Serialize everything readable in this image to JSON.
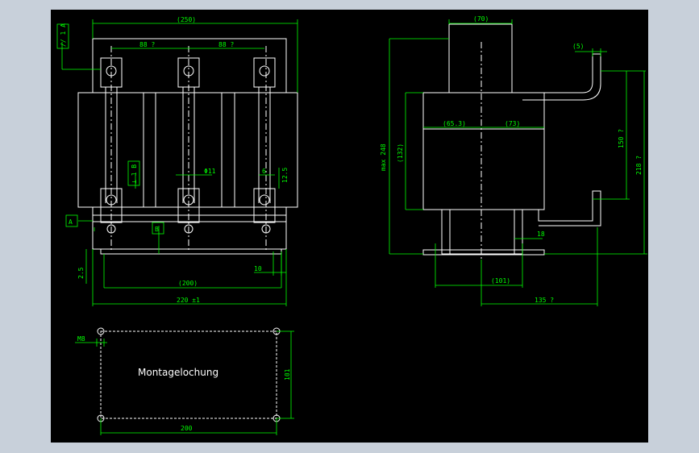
{
  "colors": {
    "outer_bg": "#c8d0da",
    "canvas_bg": "#000000",
    "drawing": "#ffffff",
    "dimension": "#00ff00"
  },
  "front_view": {
    "dim_top": "(250)",
    "dim_pitch_left": "88 ?",
    "dim_pitch_right": "88 ?",
    "hole_dia": "Φ11",
    "dim_6": "6",
    "dim_12_5": "12.5",
    "dim_bottom_inner": "(200)",
    "dim_bottom_outer": "220 ±1",
    "dim_10": "10",
    "dim_2_5": "2.5",
    "tol_parallel": "// 1 A",
    "tol_perp": "⊥ 1 B",
    "datum_a": "A",
    "datum_b": "B"
  },
  "side_view": {
    "dim_top": "(70)",
    "dim_5": "(5)",
    "dim_max_height": "max 248",
    "dim_132": "(132)",
    "dim_65_3": "(65.3)",
    "dim_73": "(73)",
    "dim_150": "150 ?",
    "dim_218": "218 ?",
    "dim_18": "18",
    "dim_101": "(101)",
    "dim_135": "135 ?"
  },
  "mounting": {
    "title": "Montagelochung",
    "hole": "M8",
    "width": "200",
    "height": "101"
  }
}
